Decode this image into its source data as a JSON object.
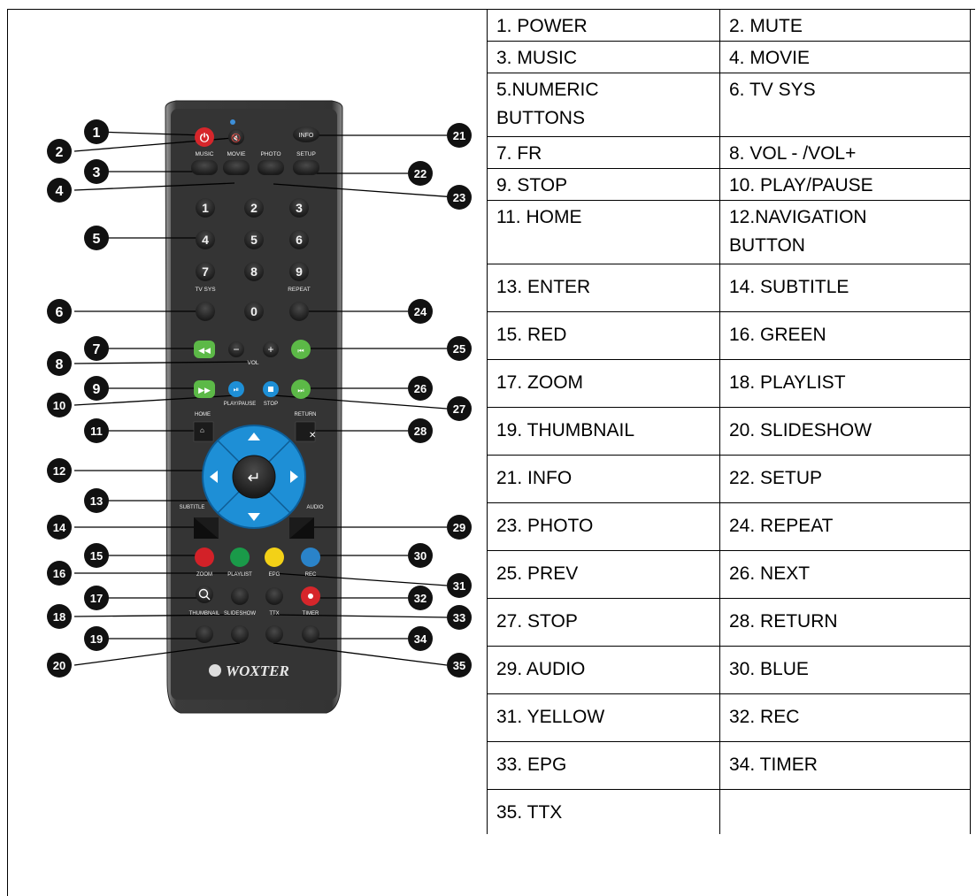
{
  "diagram": {
    "brand": "WOXTER",
    "button_text": {
      "music": "MUSIC",
      "movie": "MOVIE",
      "photo": "PHOTO",
      "setup": "SETUP",
      "info": "INFO",
      "tvsys": "TV SYS",
      "repeat": "REPEAT",
      "vol": "VOL",
      "playpause": "PLAY/PAUSE",
      "stop": "STOP",
      "home": "HOME",
      "return": "RETURN",
      "subtitle": "SUBTITLE",
      "audio": "AUDIO",
      "zoom": "ZOOM",
      "playlist": "PLAYLIST",
      "epg": "EPG",
      "rec": "REC",
      "thumbnail": "THUMBNAIL",
      "slideshow": "SLIDESHOW",
      "ttx": "TTX",
      "timer": "TIMER"
    },
    "digits": [
      "1",
      "2",
      "3",
      "4",
      "5",
      "6",
      "7",
      "8",
      "9",
      "0"
    ],
    "callouts": [
      "1",
      "2",
      "3",
      "4",
      "5",
      "6",
      "7",
      "8",
      "9",
      "10",
      "11",
      "12",
      "13",
      "14",
      "15",
      "16",
      "17",
      "18",
      "19",
      "20",
      "21",
      "22",
      "23",
      "24",
      "25",
      "26",
      "27",
      "28",
      "29",
      "30",
      "31",
      "32",
      "33",
      "34",
      "35"
    ]
  },
  "legend": {
    "rows": [
      {
        "c1": "1. POWER",
        "c2": "2. MUTE"
      },
      {
        "c1": "3. MUSIC",
        "c2": "4. MOVIE"
      },
      {
        "c1": "5.NUMERIC BUTTONS",
        "c2": "6. TV SYS"
      },
      {
        "c1": "7. FR",
        "c2": "8. VOL - /VOL+"
      },
      {
        "c1": "9. STOP",
        "c2": "10. PLAY/PAUSE"
      },
      {
        "c1": "11. HOME",
        "c2": "12.NAVIGATION BUTTON"
      },
      {
        "c1": "13. ENTER",
        "c2": "14. SUBTITLE"
      },
      {
        "c1": "15. RED",
        "c2": "16. GREEN"
      },
      {
        "c1": "17. ZOOM",
        "c2": "18. PLAYLIST"
      },
      {
        "c1": "19. THUMBNAIL",
        "c2": "20. SLIDESHOW"
      },
      {
        "c1": "21. INFO",
        "c2": "22. SETUP"
      },
      {
        "c1": "23. PHOTO",
        "c2": "24. REPEAT"
      },
      {
        "c1": "25. PREV",
        "c2": "26. NEXT"
      },
      {
        "c1": "27. STOP",
        "c2": "28. RETURN"
      },
      {
        "c1": "29. AUDIO",
        "c2": "30. BLUE"
      },
      {
        "c1": "31. YELLOW",
        "c2": "32. REC"
      },
      {
        "c1": "33. EPG",
        "c2": "34. TIMER"
      },
      {
        "c1": "35. TTX",
        "c2": ""
      }
    ]
  },
  "colors": {
    "remote_body": "#3a3a3a",
    "power": "#d6262b",
    "nav_blue": "#1e8fd6",
    "transport_green": "#5cb947",
    "red": "#d32128",
    "green": "#1a9a49",
    "yellow": "#f3d117",
    "blue": "#2a83c9",
    "rec": "#d6262b"
  }
}
